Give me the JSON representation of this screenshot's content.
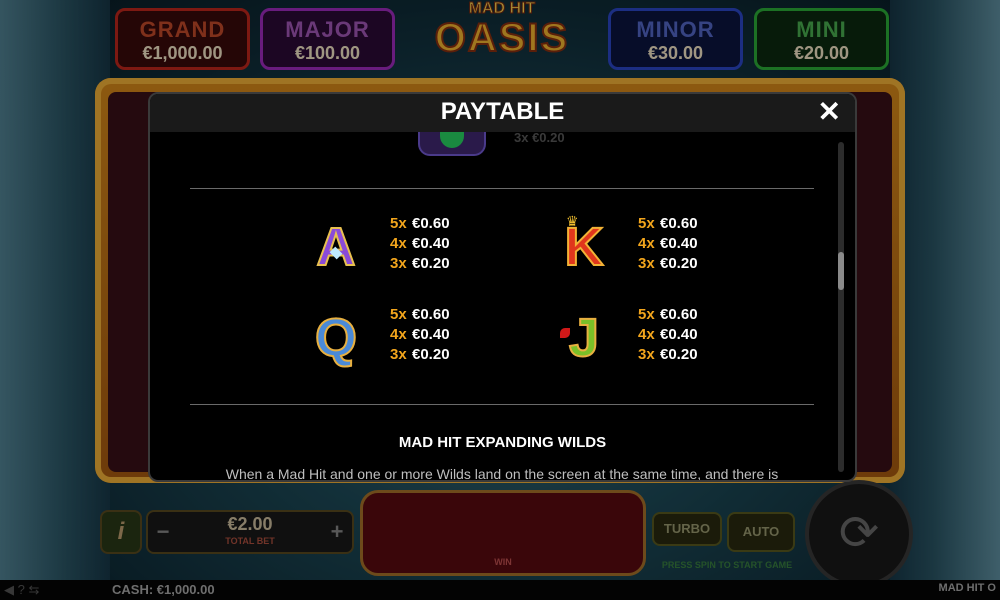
{
  "jackpots": {
    "grand": {
      "label": "GRAND",
      "value": "€1,000.00"
    },
    "major": {
      "label": "MAJOR",
      "value": "€100.00"
    },
    "minor": {
      "label": "MINOR",
      "value": "€30.00"
    },
    "mini": {
      "label": "MINI",
      "value": "€20.00"
    }
  },
  "logo": {
    "top": "MAD HIT",
    "main": "OASIS"
  },
  "modal": {
    "title": "PAYTABLE",
    "close": "✕",
    "peek_text": "3x €0.20",
    "symbols": [
      {
        "letter": "A",
        "pays": [
          {
            "mult": "5x",
            "amt": "€0.60"
          },
          {
            "mult": "4x",
            "amt": "€0.40"
          },
          {
            "mult": "3x",
            "amt": "€0.20"
          }
        ]
      },
      {
        "letter": "K",
        "pays": [
          {
            "mult": "5x",
            "amt": "€0.60"
          },
          {
            "mult": "4x",
            "amt": "€0.40"
          },
          {
            "mult": "3x",
            "amt": "€0.20"
          }
        ]
      },
      {
        "letter": "Q",
        "pays": [
          {
            "mult": "5x",
            "amt": "€0.60"
          },
          {
            "mult": "4x",
            "amt": "€0.40"
          },
          {
            "mult": "3x",
            "amt": "€0.20"
          }
        ]
      },
      {
        "letter": "J",
        "pays": [
          {
            "mult": "5x",
            "amt": "€0.60"
          },
          {
            "mult": "4x",
            "amt": "€0.40"
          },
          {
            "mult": "3x",
            "amt": "€0.20"
          }
        ]
      }
    ],
    "section_title": "MAD HIT EXPANDING WILDS",
    "section_text": "When a Mad Hit and one or more Wilds land on the screen at the same time, and there is"
  },
  "controls": {
    "info": "i",
    "minus": "−",
    "plus": "+",
    "bet_value": "€2.00",
    "bet_label": "TOTAL BET",
    "win_label": "WIN",
    "turbo": "TURBO",
    "auto": "AUTO",
    "press_spin": "PRESS SPIN TO START GAME",
    "spin_icon": "⟳"
  },
  "status": {
    "icons": "◀  ?  ⇆",
    "cash": "CASH: €1,000.00",
    "game_name": "MAD HIT O"
  }
}
